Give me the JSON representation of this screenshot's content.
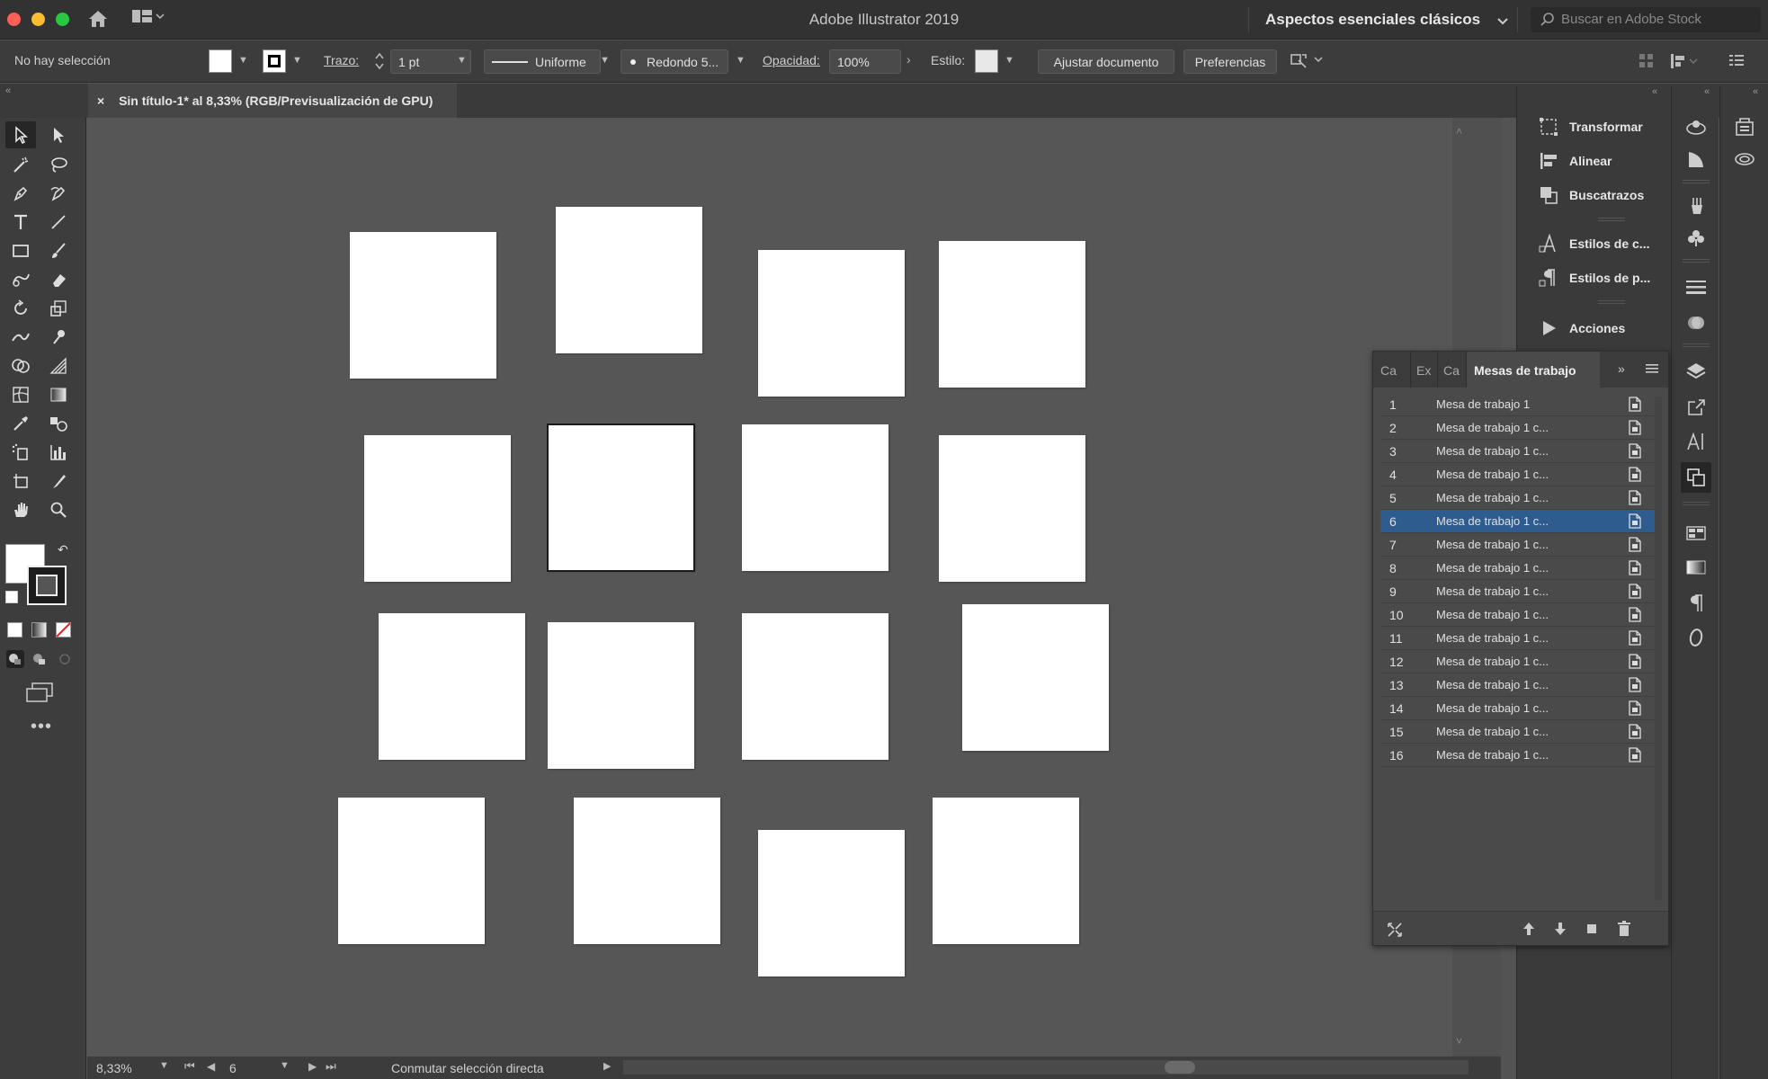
{
  "app": {
    "title": "Adobe Illustrator 2019",
    "workspace": "Aspectos esenciales clásicos",
    "stock_search_placeholder": "Buscar en Adobe Stock"
  },
  "control_bar": {
    "selection": "No hay selección",
    "stroke_label": "Trazo:",
    "stroke_value": "1 pt",
    "profile": "Uniforme",
    "brush": "Redondo 5...",
    "opacity_label": "Opacidad:",
    "opacity_value": "100%",
    "style_label": "Estilo:",
    "fit_document": "Ajustar documento",
    "preferences": "Preferencias"
  },
  "document": {
    "tab_title": "Sin título-1* al 8,33% (RGB/Previsualización de GPU)",
    "tab_close": "×"
  },
  "status": {
    "zoom": "8,33%",
    "artboard_nav": "6",
    "message": "Conmutar selección directa"
  },
  "dock": {
    "items": [
      "Transformar",
      "Alinear",
      "Buscatrazos",
      "Estilos de c...",
      "Estilos de p...",
      "Acciones"
    ]
  },
  "artboards_panel": {
    "tabs": [
      "Ca",
      "Ex",
      "Ca"
    ],
    "active_tab": "Mesas de trabajo",
    "selected": 6,
    "rows": [
      {
        "num": "1",
        "name": "Mesa de trabajo 1"
      },
      {
        "num": "2",
        "name": "Mesa de trabajo 1 c..."
      },
      {
        "num": "3",
        "name": "Mesa de trabajo 1 c..."
      },
      {
        "num": "4",
        "name": "Mesa de trabajo 1 c..."
      },
      {
        "num": "5",
        "name": "Mesa de trabajo 1 c..."
      },
      {
        "num": "6",
        "name": "Mesa de trabajo 1 c..."
      },
      {
        "num": "7",
        "name": "Mesa de trabajo 1 c..."
      },
      {
        "num": "8",
        "name": "Mesa de trabajo 1 c..."
      },
      {
        "num": "9",
        "name": "Mesa de trabajo 1 c..."
      },
      {
        "num": "10",
        "name": "Mesa de trabajo 1 c..."
      },
      {
        "num": "11",
        "name": "Mesa de trabajo 1 c..."
      },
      {
        "num": "12",
        "name": "Mesa de trabajo 1 c..."
      },
      {
        "num": "13",
        "name": "Mesa de trabajo 1 c..."
      },
      {
        "num": "14",
        "name": "Mesa de trabajo 1 c..."
      },
      {
        "num": "15",
        "name": "Mesa de trabajo 1 c..."
      },
      {
        "num": "16",
        "name": "Mesa de trabajo 1 c..."
      }
    ]
  },
  "colors": {
    "selection_row": "#2f5c8e",
    "canvas": "#565656",
    "artboard": "#ffffff"
  }
}
